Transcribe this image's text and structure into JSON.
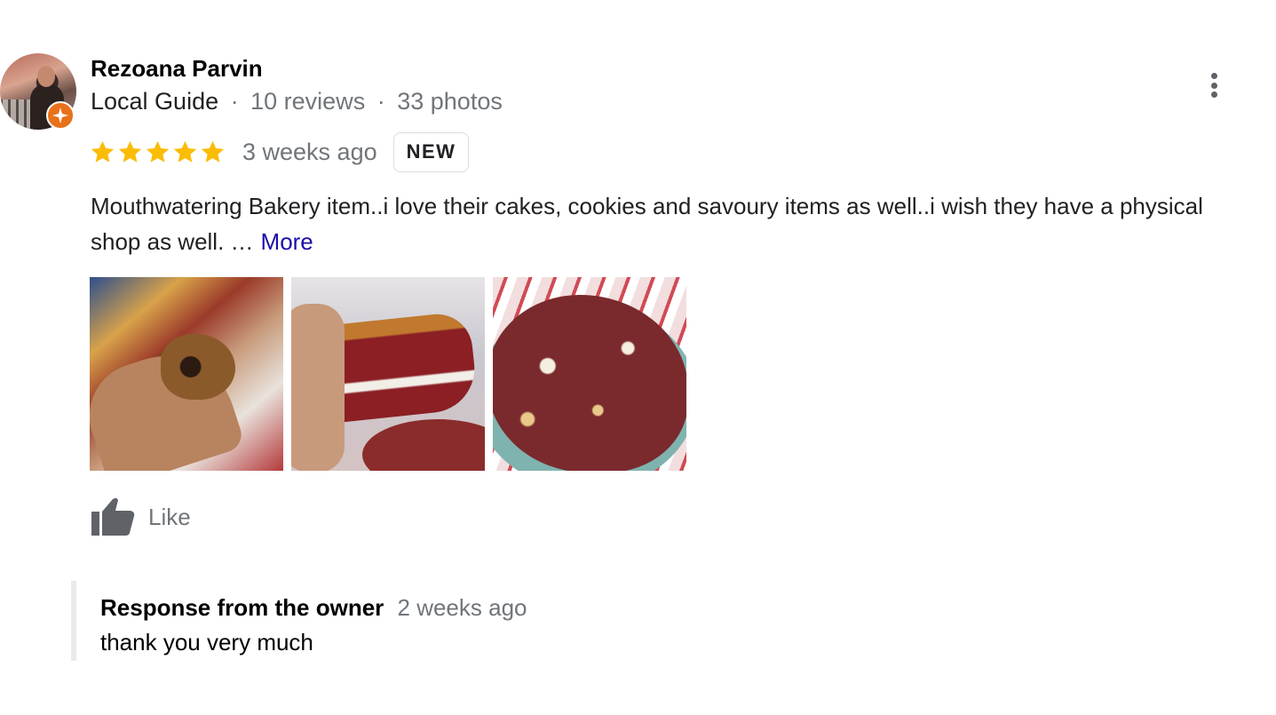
{
  "reviewer": {
    "name": "Rezoana Parvin",
    "guide_label": "Local Guide",
    "reviews": "10 reviews",
    "photos": "33 photos",
    "separator": "·"
  },
  "review": {
    "rating": 5,
    "time_ago": "3 weeks ago",
    "badge": "NEW",
    "text": "Mouthwatering Bakery item..i love their cakes, cookies and savoury items as well..i wish they have a physical shop as well. …",
    "more_label": "More",
    "photo_names": [
      "cookie-photo-1",
      "cookie-photo-2",
      "cookie-photo-3"
    ]
  },
  "actions": {
    "like_label": "Like"
  },
  "owner_response": {
    "title": "Response from the owner",
    "time_ago": "2 weeks ago",
    "message": "thank you very much"
  },
  "colors": {
    "star": "#fbbc04",
    "link": "#1a0dab",
    "muted": "#70757a",
    "guide_badge": "#e8711a"
  },
  "icons": {
    "menu": "more-vert-icon",
    "like": "thumb-up-icon",
    "guide": "local-guide-badge-icon",
    "star": "star-icon"
  }
}
